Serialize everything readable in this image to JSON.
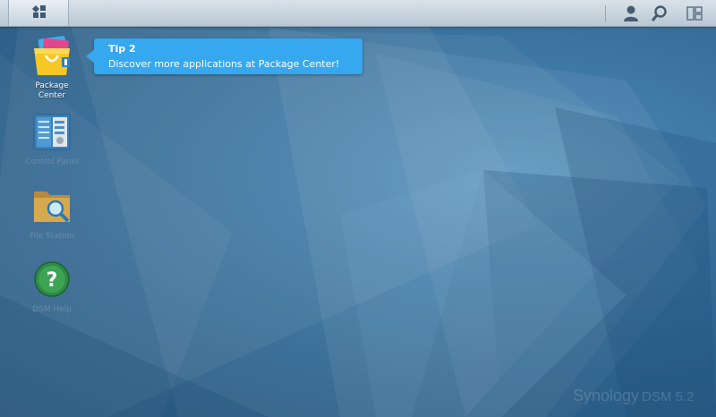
{
  "taskbar": {
    "icons": [
      "main-menu-icon",
      "user-icon",
      "search-icon",
      "widgets-icon"
    ]
  },
  "desktop_icons": [
    {
      "label": "Package\nCenter",
      "icon": "package-center-icon"
    },
    {
      "label": "Control Panel",
      "icon": "control-panel-icon"
    },
    {
      "label": "File Station",
      "icon": "file-station-icon"
    },
    {
      "label": "DSM Help",
      "icon": "help-icon"
    }
  ],
  "tip": {
    "title": "Tip 2",
    "text": "Discover more applications at Package Center!"
  },
  "branding": {
    "name": "Synology",
    "version": "DSM 5.2"
  },
  "colors": {
    "tip_background": "#35a8f0",
    "desktop_background": "#336993",
    "taskbar": "#c9d4de"
  }
}
